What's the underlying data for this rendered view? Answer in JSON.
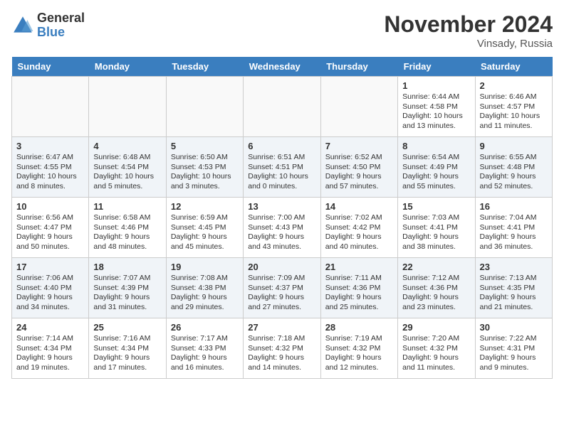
{
  "header": {
    "logo_line1": "General",
    "logo_line2": "Blue",
    "month": "November 2024",
    "location": "Vinsady, Russia"
  },
  "weekdays": [
    "Sunday",
    "Monday",
    "Tuesday",
    "Wednesday",
    "Thursday",
    "Friday",
    "Saturday"
  ],
  "weeks": [
    [
      {
        "day": "",
        "info": ""
      },
      {
        "day": "",
        "info": ""
      },
      {
        "day": "",
        "info": ""
      },
      {
        "day": "",
        "info": ""
      },
      {
        "day": "",
        "info": ""
      },
      {
        "day": "1",
        "info": "Sunrise: 6:44 AM\nSunset: 4:58 PM\nDaylight: 10 hours and 13 minutes."
      },
      {
        "day": "2",
        "info": "Sunrise: 6:46 AM\nSunset: 4:57 PM\nDaylight: 10 hours and 11 minutes."
      }
    ],
    [
      {
        "day": "3",
        "info": "Sunrise: 6:47 AM\nSunset: 4:55 PM\nDaylight: 10 hours and 8 minutes."
      },
      {
        "day": "4",
        "info": "Sunrise: 6:48 AM\nSunset: 4:54 PM\nDaylight: 10 hours and 5 minutes."
      },
      {
        "day": "5",
        "info": "Sunrise: 6:50 AM\nSunset: 4:53 PM\nDaylight: 10 hours and 3 minutes."
      },
      {
        "day": "6",
        "info": "Sunrise: 6:51 AM\nSunset: 4:51 PM\nDaylight: 10 hours and 0 minutes."
      },
      {
        "day": "7",
        "info": "Sunrise: 6:52 AM\nSunset: 4:50 PM\nDaylight: 9 hours and 57 minutes."
      },
      {
        "day": "8",
        "info": "Sunrise: 6:54 AM\nSunset: 4:49 PM\nDaylight: 9 hours and 55 minutes."
      },
      {
        "day": "9",
        "info": "Sunrise: 6:55 AM\nSunset: 4:48 PM\nDaylight: 9 hours and 52 minutes."
      }
    ],
    [
      {
        "day": "10",
        "info": "Sunrise: 6:56 AM\nSunset: 4:47 PM\nDaylight: 9 hours and 50 minutes."
      },
      {
        "day": "11",
        "info": "Sunrise: 6:58 AM\nSunset: 4:46 PM\nDaylight: 9 hours and 48 minutes."
      },
      {
        "day": "12",
        "info": "Sunrise: 6:59 AM\nSunset: 4:45 PM\nDaylight: 9 hours and 45 minutes."
      },
      {
        "day": "13",
        "info": "Sunrise: 7:00 AM\nSunset: 4:43 PM\nDaylight: 9 hours and 43 minutes."
      },
      {
        "day": "14",
        "info": "Sunrise: 7:02 AM\nSunset: 4:42 PM\nDaylight: 9 hours and 40 minutes."
      },
      {
        "day": "15",
        "info": "Sunrise: 7:03 AM\nSunset: 4:41 PM\nDaylight: 9 hours and 38 minutes."
      },
      {
        "day": "16",
        "info": "Sunrise: 7:04 AM\nSunset: 4:41 PM\nDaylight: 9 hours and 36 minutes."
      }
    ],
    [
      {
        "day": "17",
        "info": "Sunrise: 7:06 AM\nSunset: 4:40 PM\nDaylight: 9 hours and 34 minutes."
      },
      {
        "day": "18",
        "info": "Sunrise: 7:07 AM\nSunset: 4:39 PM\nDaylight: 9 hours and 31 minutes."
      },
      {
        "day": "19",
        "info": "Sunrise: 7:08 AM\nSunset: 4:38 PM\nDaylight: 9 hours and 29 minutes."
      },
      {
        "day": "20",
        "info": "Sunrise: 7:09 AM\nSunset: 4:37 PM\nDaylight: 9 hours and 27 minutes."
      },
      {
        "day": "21",
        "info": "Sunrise: 7:11 AM\nSunset: 4:36 PM\nDaylight: 9 hours and 25 minutes."
      },
      {
        "day": "22",
        "info": "Sunrise: 7:12 AM\nSunset: 4:36 PM\nDaylight: 9 hours and 23 minutes."
      },
      {
        "day": "23",
        "info": "Sunrise: 7:13 AM\nSunset: 4:35 PM\nDaylight: 9 hours and 21 minutes."
      }
    ],
    [
      {
        "day": "24",
        "info": "Sunrise: 7:14 AM\nSunset: 4:34 PM\nDaylight: 9 hours and 19 minutes."
      },
      {
        "day": "25",
        "info": "Sunrise: 7:16 AM\nSunset: 4:34 PM\nDaylight: 9 hours and 17 minutes."
      },
      {
        "day": "26",
        "info": "Sunrise: 7:17 AM\nSunset: 4:33 PM\nDaylight: 9 hours and 16 minutes."
      },
      {
        "day": "27",
        "info": "Sunrise: 7:18 AM\nSunset: 4:32 PM\nDaylight: 9 hours and 14 minutes."
      },
      {
        "day": "28",
        "info": "Sunrise: 7:19 AM\nSunset: 4:32 PM\nDaylight: 9 hours and 12 minutes."
      },
      {
        "day": "29",
        "info": "Sunrise: 7:20 AM\nSunset: 4:32 PM\nDaylight: 9 hours and 11 minutes."
      },
      {
        "day": "30",
        "info": "Sunrise: 7:22 AM\nSunset: 4:31 PM\nDaylight: 9 hours and 9 minutes."
      }
    ]
  ]
}
